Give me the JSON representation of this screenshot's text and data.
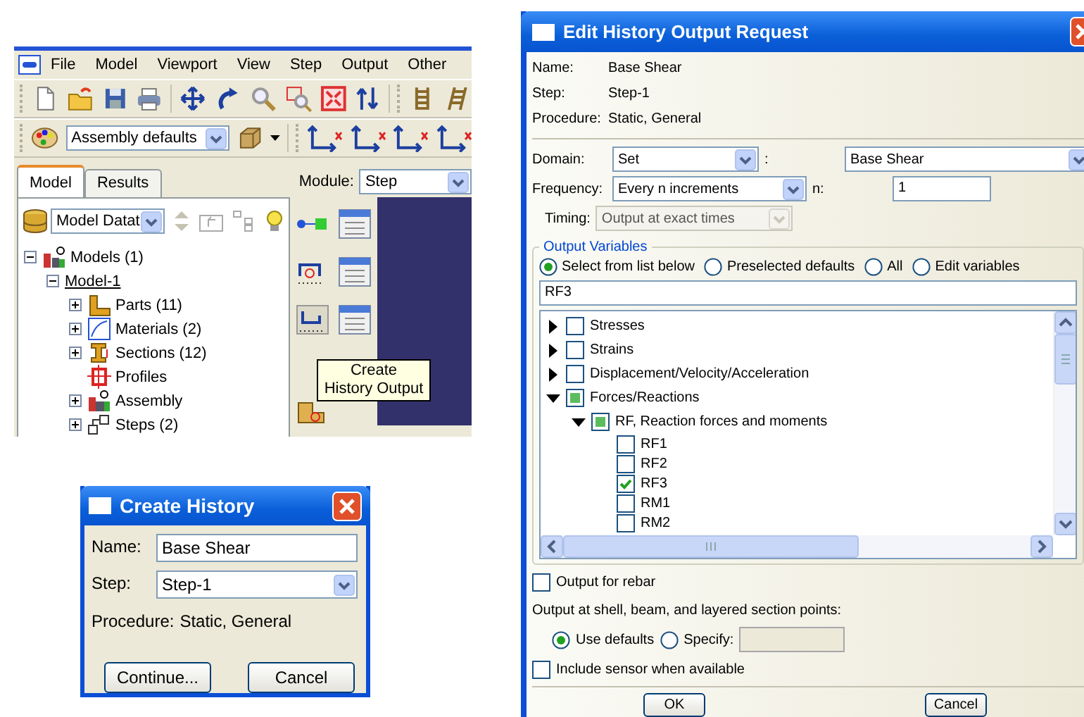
{
  "main_window": {
    "menu": [
      "File",
      "Model",
      "Viewport",
      "View",
      "Step",
      "Output",
      "Other"
    ],
    "render_style": "Assembly defaults",
    "tabs": [
      {
        "label": "Model",
        "selected": true
      },
      {
        "label": "Results",
        "selected": false
      }
    ],
    "module_label": "Module:",
    "module": "Step",
    "database_selector": "Model Datat",
    "tree": [
      {
        "label": "Models (1)",
        "kind": "models",
        "expanded": true,
        "current": false,
        "children": [
          {
            "label": "Model-1",
            "expanded": true,
            "current": true,
            "children": [
              {
                "label": "Parts (11)",
                "kind": "part",
                "expanded": false,
                "current": false
              },
              {
                "label": "Materials (2)",
                "kind": "material",
                "expanded": false,
                "current": false
              },
              {
                "label": "Sections (12)",
                "kind": "section",
                "expanded": false,
                "current": false
              },
              {
                "label": "Profiles",
                "kind": "profile",
                "current": false
              },
              {
                "label": "Assembly",
                "kind": "assembly",
                "expanded": false,
                "current": false
              },
              {
                "label": "Steps (2)",
                "kind": "step",
                "expanded": false,
                "current": false
              }
            ]
          }
        ]
      }
    ],
    "tooltip": "Create\nHistory Output"
  },
  "create_dialog": {
    "title": "Create History",
    "name_label": "Name:",
    "name": "Base Shear",
    "step_label": "Step:",
    "step": "Step-1",
    "procedure_label": "Procedure:",
    "procedure": "Static, General",
    "buttons": [
      "Continue...",
      "Cancel"
    ]
  },
  "edit_dialog": {
    "title": "Edit History Output Request",
    "info": [
      {
        "label": "Name:",
        "value": "Base Shear"
      },
      {
        "label": "Step:",
        "value": "Step-1"
      },
      {
        "label": "Procedure:",
        "value": "Static, General"
      }
    ],
    "domain_label": "Domain:",
    "domain": "Set",
    "domain_separator": ":",
    "domain_set": "Base Shear",
    "frequency_label": "Frequency:",
    "frequency": "Every n increments",
    "n_label": "n:",
    "n": "1",
    "timing_label": "Timing:",
    "timing": "Output at exact times",
    "timing_disabled": true,
    "output_variables": {
      "title": "Output Variables",
      "options": [
        {
          "label": "Select from list below",
          "selected": true
        },
        {
          "label": "Preselected defaults",
          "selected": false
        },
        {
          "label": "All",
          "selected": false
        },
        {
          "label": "Edit variables",
          "selected": false
        }
      ],
      "filter": "RF3",
      "tree": [
        {
          "label": "Stresses",
          "expanded": false,
          "checked": false,
          "partial": false
        },
        {
          "label": "Strains",
          "expanded": false,
          "checked": false,
          "partial": false
        },
        {
          "label": "Displacement/Velocity/Acceleration",
          "expanded": false,
          "checked": false,
          "partial": false
        },
        {
          "label": "Forces/Reactions",
          "expanded": true,
          "checked": false,
          "partial": true,
          "children": [
            {
              "label": "RF, Reaction forces and moments",
              "expanded": true,
              "checked": false,
              "partial": true,
              "children": [
                {
                  "label": "RF1",
                  "checked": false,
                  "partial": false
                },
                {
                  "label": "RF2",
                  "checked": false,
                  "partial": false
                },
                {
                  "label": "RF3",
                  "checked": true,
                  "partial": false
                },
                {
                  "label": "RM1",
                  "checked": false,
                  "partial": false
                },
                {
                  "label": "RM2",
                  "checked": false,
                  "partial": false
                }
              ]
            }
          ]
        }
      ]
    },
    "rebar": {
      "label": "Output for rebar",
      "checked": false
    },
    "section_points_label": "Output at shell, beam, and layered section points:",
    "section_points": [
      {
        "label": "Use defaults",
        "selected": true
      },
      {
        "label": "Specify:",
        "selected": false
      }
    ],
    "specify_disabled": true,
    "sensor": {
      "label": "Include sensor when available",
      "checked": false
    },
    "buttons": [
      "OK",
      "Cancel"
    ]
  }
}
